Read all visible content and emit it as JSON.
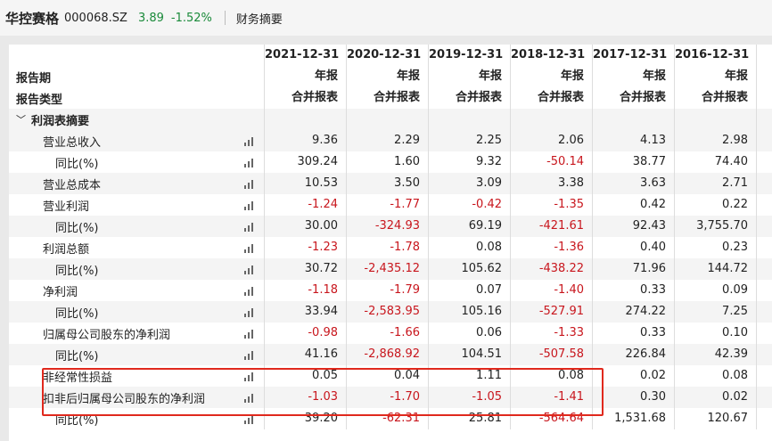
{
  "header": {
    "title": "华控赛格",
    "code": "000068.SZ",
    "price": "3.89",
    "change": "-1.52%",
    "tab": "财务摘要"
  },
  "table": {
    "dates": [
      "2021-12-31",
      "2020-12-31",
      "2019-12-31",
      "2018-12-31",
      "2017-12-31",
      "2016-12-31",
      "20"
    ],
    "report_period_label": "报告期",
    "report_type_label": "报告类型",
    "report_period_values": [
      "年报",
      "年报",
      "年报",
      "年报",
      "年报",
      "年报",
      ""
    ],
    "report_type_values": [
      "合并报表",
      "合并报表",
      "合并报表",
      "合并报表",
      "合并报表",
      "合并报表",
      ""
    ],
    "section_label": "利润表摘要",
    "rows": [
      {
        "label": "营业总收入",
        "level": 1,
        "values": [
          "9.36",
          "2.29",
          "2.25",
          "2.06",
          "4.13",
          "2.98"
        ]
      },
      {
        "label": "同比(%)",
        "level": 2,
        "values": [
          "309.24",
          "1.60",
          "9.32",
          "-50.14",
          "38.77",
          "74.40"
        ]
      },
      {
        "label": "营业总成本",
        "level": 1,
        "values": [
          "10.53",
          "3.50",
          "3.09",
          "3.38",
          "3.63",
          "2.71"
        ]
      },
      {
        "label": "营业利润",
        "level": 1,
        "values": [
          "-1.24",
          "-1.77",
          "-0.42",
          "-1.35",
          "0.42",
          "0.22"
        ]
      },
      {
        "label": "同比(%)",
        "level": 2,
        "values": [
          "30.00",
          "-324.93",
          "69.19",
          "-421.61",
          "92.43",
          "3,755.70"
        ]
      },
      {
        "label": "利润总额",
        "level": 1,
        "values": [
          "-1.23",
          "-1.78",
          "0.08",
          "-1.36",
          "0.40",
          "0.23"
        ]
      },
      {
        "label": "同比(%)",
        "level": 2,
        "values": [
          "30.72",
          "-2,435.12",
          "105.62",
          "-438.22",
          "71.96",
          "144.72"
        ]
      },
      {
        "label": "净利润",
        "level": 1,
        "values": [
          "-1.18",
          "-1.79",
          "0.07",
          "-1.40",
          "0.33",
          "0.09"
        ]
      },
      {
        "label": "同比(%)",
        "level": 2,
        "values": [
          "33.94",
          "-2,583.95",
          "105.16",
          "-527.91",
          "274.22",
          "7.25"
        ]
      },
      {
        "label": "归属母公司股东的净利润",
        "level": 1,
        "values": [
          "-0.98",
          "-1.66",
          "0.06",
          "-1.33",
          "0.33",
          "0.10"
        ]
      },
      {
        "label": "同比(%)",
        "level": 2,
        "values": [
          "41.16",
          "-2,868.92",
          "104.51",
          "-507.58",
          "226.84",
          "42.39"
        ]
      },
      {
        "label": "非经常性损益",
        "level": 1,
        "values": [
          "0.05",
          "0.04",
          "1.11",
          "0.08",
          "0.02",
          "0.08"
        ]
      },
      {
        "label": "扣非后归属母公司股东的净利润",
        "level": 1,
        "values": [
          "-1.03",
          "-1.70",
          "-1.05",
          "-1.41",
          "0.30",
          "0.02"
        ]
      },
      {
        "label": "同比(%)",
        "level": 2,
        "values": [
          "39.20",
          "-62.31",
          "25.81",
          "-564.64",
          "1,531.68",
          "120.67"
        ]
      }
    ]
  },
  "colors": {
    "negative": "#c8161d",
    "positive": "#1a8a3a",
    "highlight": "#e0291d"
  }
}
